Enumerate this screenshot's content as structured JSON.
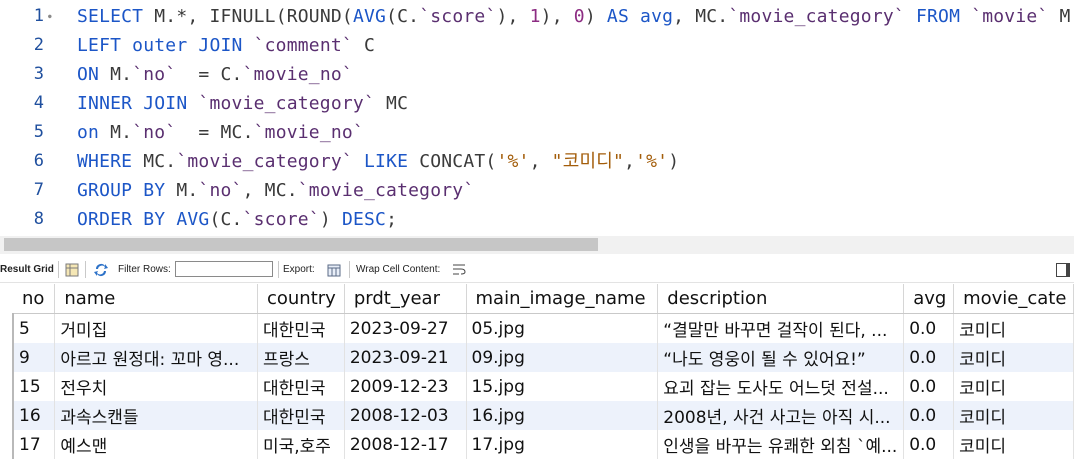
{
  "editor": {
    "lines": [
      {
        "num": "1",
        "fold": true,
        "html_parts": [
          [
            "kw",
            "SELECT "
          ],
          [
            "id",
            "M.*, "
          ],
          [
            "fn2",
            "IFNULL"
          ],
          [
            "id",
            "("
          ],
          [
            "fn2",
            "ROUND"
          ],
          [
            "id",
            "("
          ],
          [
            "fn",
            "AVG"
          ],
          [
            "id",
            "(C."
          ],
          [
            "bt",
            "`score`"
          ],
          [
            "id",
            "), "
          ],
          [
            "num",
            "1"
          ],
          [
            "id",
            "), "
          ],
          [
            "num",
            "0"
          ],
          [
            "id",
            ") "
          ],
          [
            "kw",
            "AS "
          ],
          [
            "kw",
            "avg"
          ],
          [
            "id",
            ", MC."
          ],
          [
            "bt",
            "`movie_category` "
          ],
          [
            "kw",
            "FROM "
          ],
          [
            "bt",
            "`movie` "
          ],
          [
            "id",
            "M"
          ]
        ]
      },
      {
        "num": "2",
        "fold": false,
        "html_parts": [
          [
            "kw",
            "LEFT outer JOIN "
          ],
          [
            "bt",
            "`comment` "
          ],
          [
            "id",
            "C"
          ]
        ]
      },
      {
        "num": "3",
        "fold": false,
        "html_parts": [
          [
            "kw",
            "ON "
          ],
          [
            "id",
            "M."
          ],
          [
            "bt",
            "`no` "
          ],
          [
            "id",
            " = C."
          ],
          [
            "bt",
            "`movie_no`"
          ]
        ]
      },
      {
        "num": "4",
        "fold": false,
        "html_parts": [
          [
            "kw",
            "INNER JOIN "
          ],
          [
            "bt",
            "`movie_category` "
          ],
          [
            "id",
            "MC"
          ]
        ]
      },
      {
        "num": "5",
        "fold": false,
        "html_parts": [
          [
            "kw",
            "on "
          ],
          [
            "id",
            "M."
          ],
          [
            "bt",
            "`no` "
          ],
          [
            "id",
            " = MC."
          ],
          [
            "bt",
            "`movie_no`"
          ]
        ]
      },
      {
        "num": "6",
        "fold": false,
        "html_parts": [
          [
            "kw",
            "WHERE "
          ],
          [
            "id",
            "MC."
          ],
          [
            "bt",
            "`movie_category` "
          ],
          [
            "kw",
            "LIKE "
          ],
          [
            "fn2",
            "CONCAT"
          ],
          [
            "id",
            "("
          ],
          [
            "str",
            "'%'"
          ],
          [
            "id",
            ", "
          ],
          [
            "str",
            "\"코미디\""
          ],
          [
            "id",
            ","
          ],
          [
            "str",
            "'%'"
          ],
          [
            "id",
            ")"
          ]
        ]
      },
      {
        "num": "7",
        "fold": false,
        "html_parts": [
          [
            "kw",
            "GROUP BY "
          ],
          [
            "id",
            "M."
          ],
          [
            "bt",
            "`no`"
          ],
          [
            "id",
            ", MC."
          ],
          [
            "bt",
            "`movie_category`"
          ]
        ]
      },
      {
        "num": "8",
        "fold": false,
        "html_parts": [
          [
            "kw",
            "ORDER BY "
          ],
          [
            "fn",
            "AVG"
          ],
          [
            "id",
            "(C."
          ],
          [
            "bt",
            "`score`"
          ],
          [
            "id",
            ") "
          ],
          [
            "kw",
            "DESC"
          ],
          [
            "id",
            ";"
          ]
        ]
      }
    ]
  },
  "toolbar": {
    "result_grid": "Result Grid",
    "filter_rows": "Filter Rows:",
    "filter_value": "",
    "export": "Export:",
    "wrap": "Wrap Cell Content:"
  },
  "grid": {
    "columns": [
      "no",
      "name",
      "country",
      "prdt_year",
      "main_image_name",
      "description",
      "avg",
      "movie_cate"
    ],
    "rows": [
      [
        "5",
        "거미집",
        "대한민국",
        "2023-09-27",
        "05.jpg",
        "“결말만 바꾸면 걸작이 된다, ...",
        "0.0",
        "코미디"
      ],
      [
        "9",
        "아르고 원정대: 꼬마 영...",
        "프랑스",
        "2023-09-21",
        "09.jpg",
        "“나도 영웅이 될 수 있어요!”",
        "0.0",
        "코미디"
      ],
      [
        "15",
        "전우치",
        "대한민국",
        "2009-12-23",
        "15.jpg",
        "요괴 잡는 도사도 어느덧 전설...",
        "0.0",
        "코미디"
      ],
      [
        "16",
        "과속스캔들",
        "대한민국",
        "2008-12-03",
        "16.jpg",
        "2008년, 사건 사고는 아직 시...",
        "0.0",
        "코미디"
      ],
      [
        "17",
        "예스맨",
        "미국,호주",
        "2008-12-17",
        "17.jpg",
        "인생을 바꾸는 유쾌한 외침 `예...",
        "0.0",
        "코미디"
      ]
    ]
  }
}
